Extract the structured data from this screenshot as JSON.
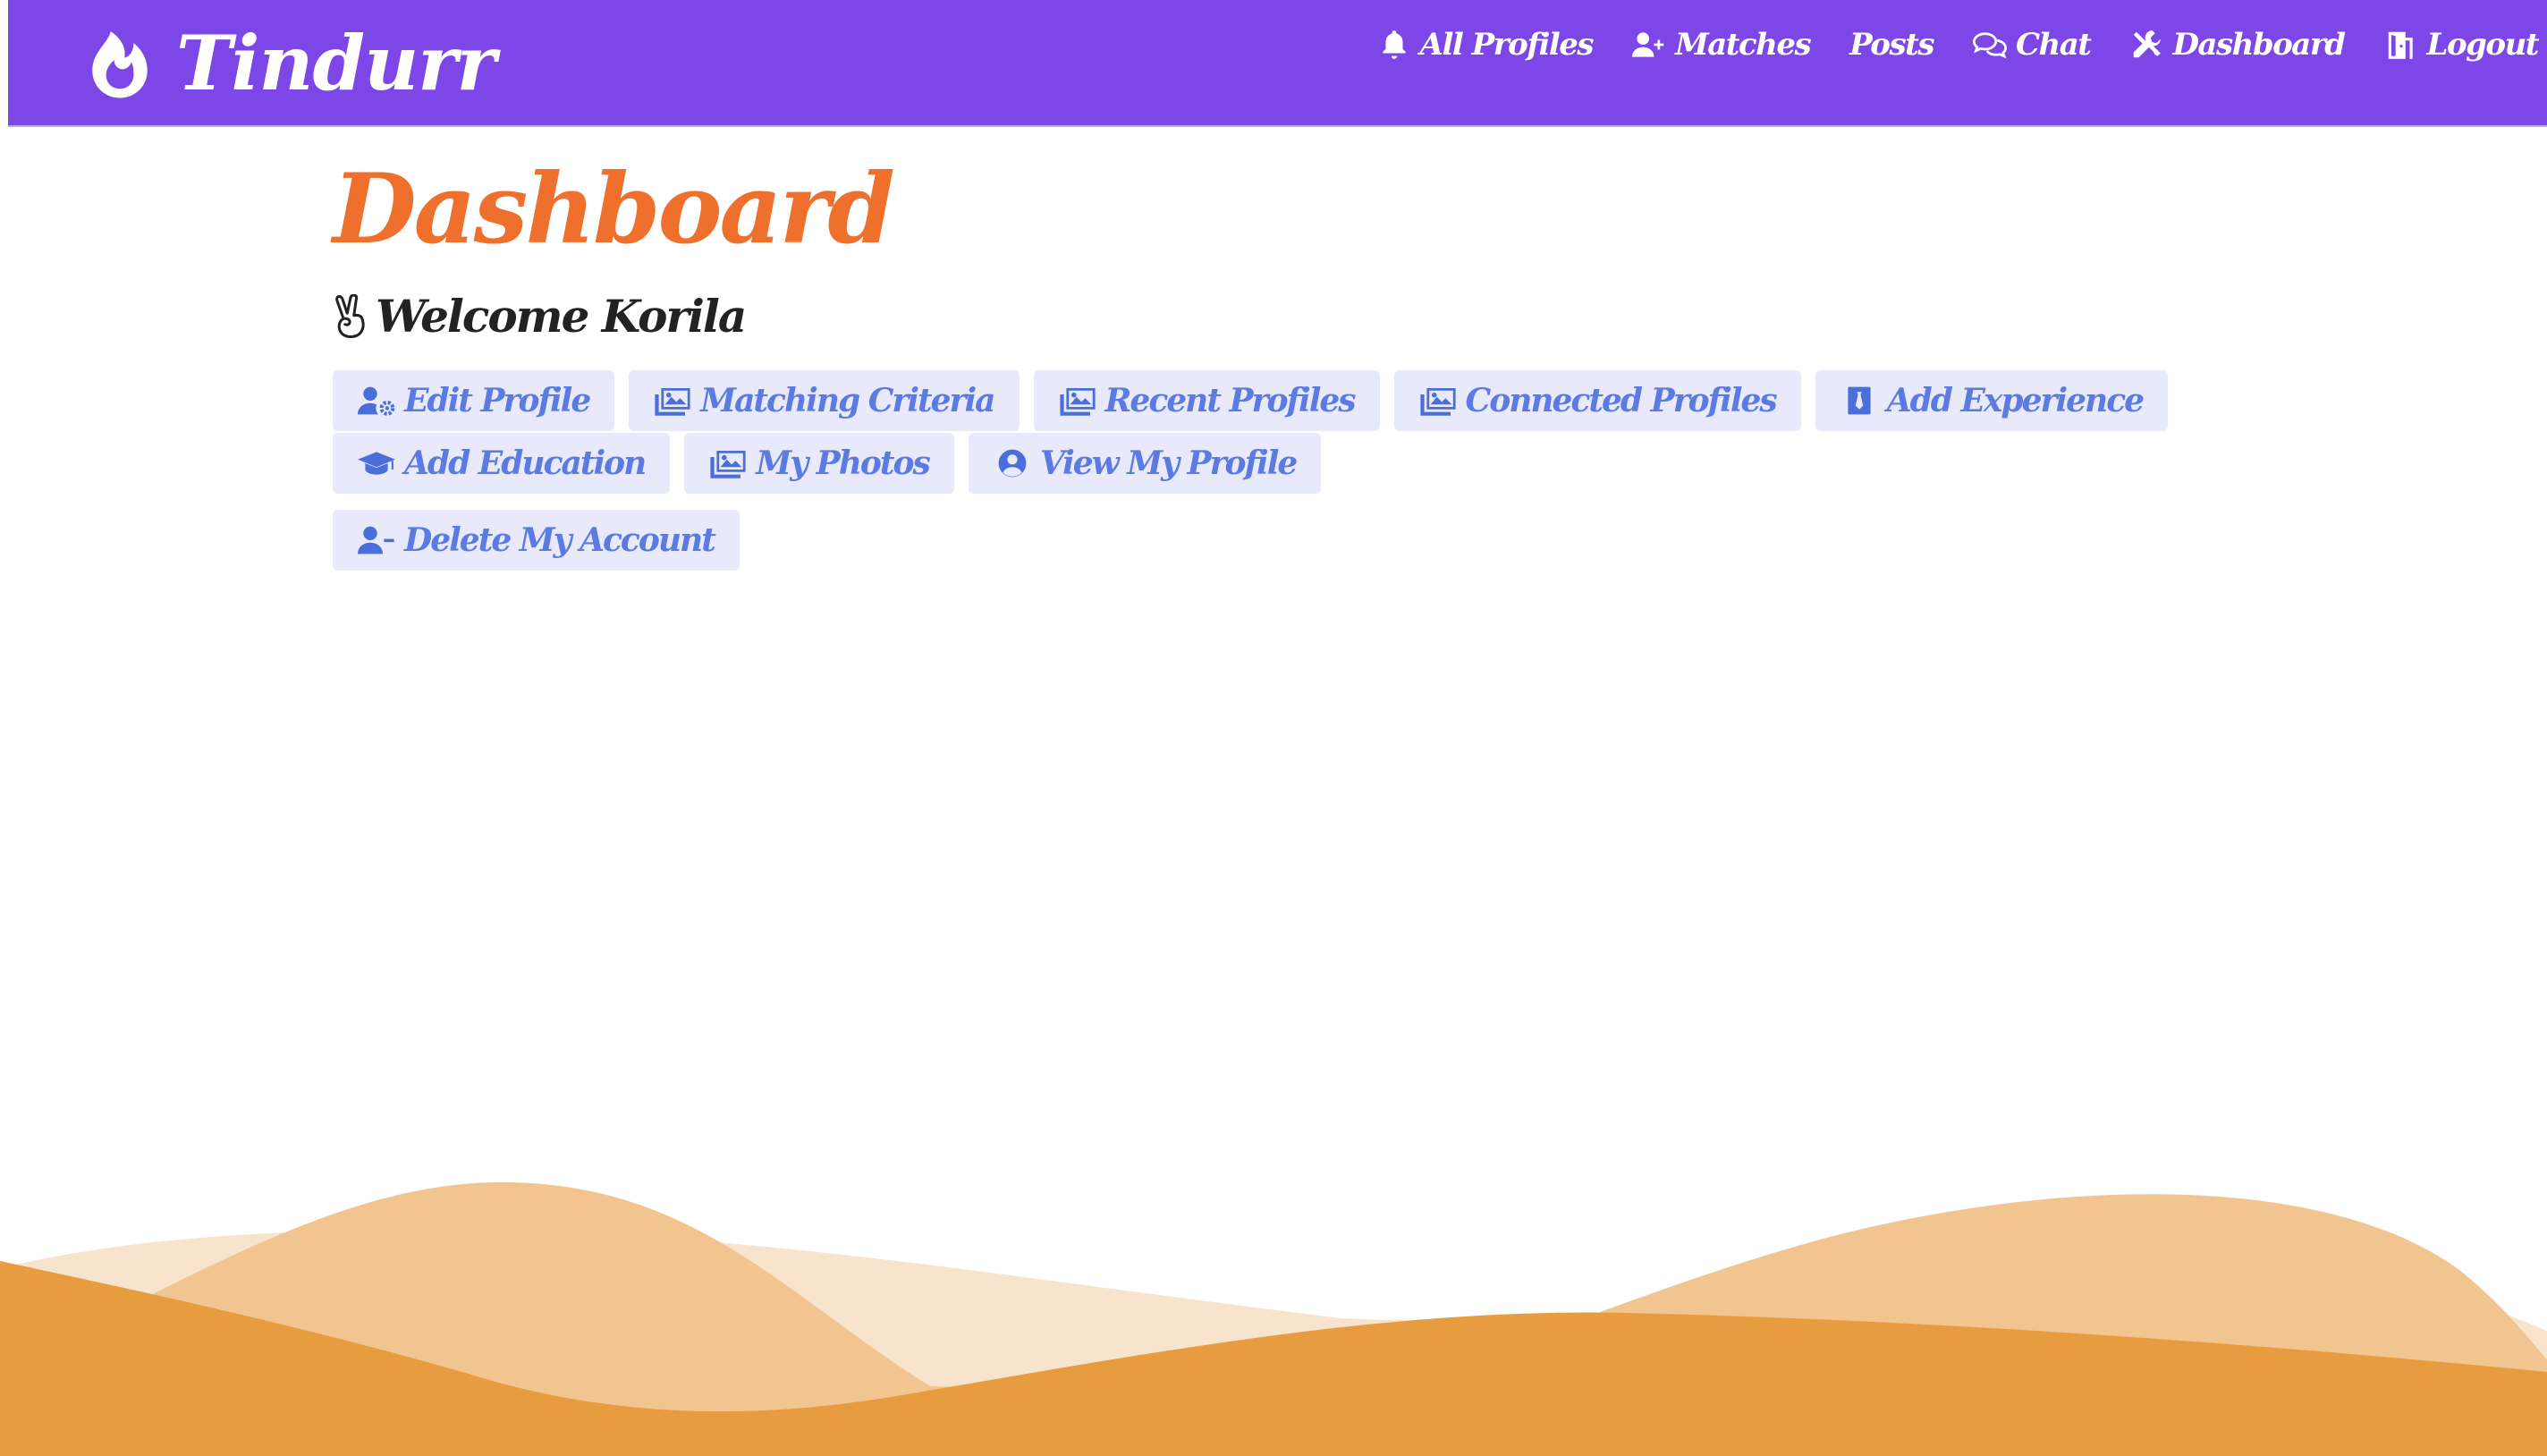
{
  "brand": {
    "name": "Tindurr",
    "icon": "flame-icon"
  },
  "nav": {
    "items": [
      {
        "label": "All Profiles",
        "icon": "bell-icon"
      },
      {
        "label": "Matches",
        "icon": "user-plus-icon"
      },
      {
        "label": "Posts",
        "icon": ""
      },
      {
        "label": "Chat",
        "icon": "comments-icon"
      },
      {
        "label": "Dashboard",
        "icon": "tools-icon"
      },
      {
        "label": "Logout",
        "icon": "door-icon"
      }
    ]
  },
  "main": {
    "title": "Dashboard",
    "welcome": "Welcome Korila",
    "welcome_icon": "peace-hand-icon",
    "buttons": [
      {
        "label": "Edit Profile",
        "icon": "user-cog-icon"
      },
      {
        "label": "Matching Criteria",
        "icon": "images-icon"
      },
      {
        "label": "Recent Profiles",
        "icon": "images-icon"
      },
      {
        "label": "Connected Profiles",
        "icon": "images-icon"
      },
      {
        "label": "Add Experience",
        "icon": "user-tie-icon"
      },
      {
        "label": "Add Education",
        "icon": "graduation-cap-icon"
      },
      {
        "label": "My Photos",
        "icon": "images-icon"
      },
      {
        "label": "View My Profile",
        "icon": "user-circle-icon"
      },
      {
        "label": "Delete My Account",
        "icon": "user-minus-icon"
      }
    ]
  },
  "colors": {
    "navbar": "#7d47e8",
    "title": "#ef6f2c",
    "button_bg": "#e8eafb",
    "button_text": "#5b7be2",
    "wave_light": "#f8e4cc",
    "wave_mid": "#f2c590",
    "wave_dark": "#e89c40"
  }
}
